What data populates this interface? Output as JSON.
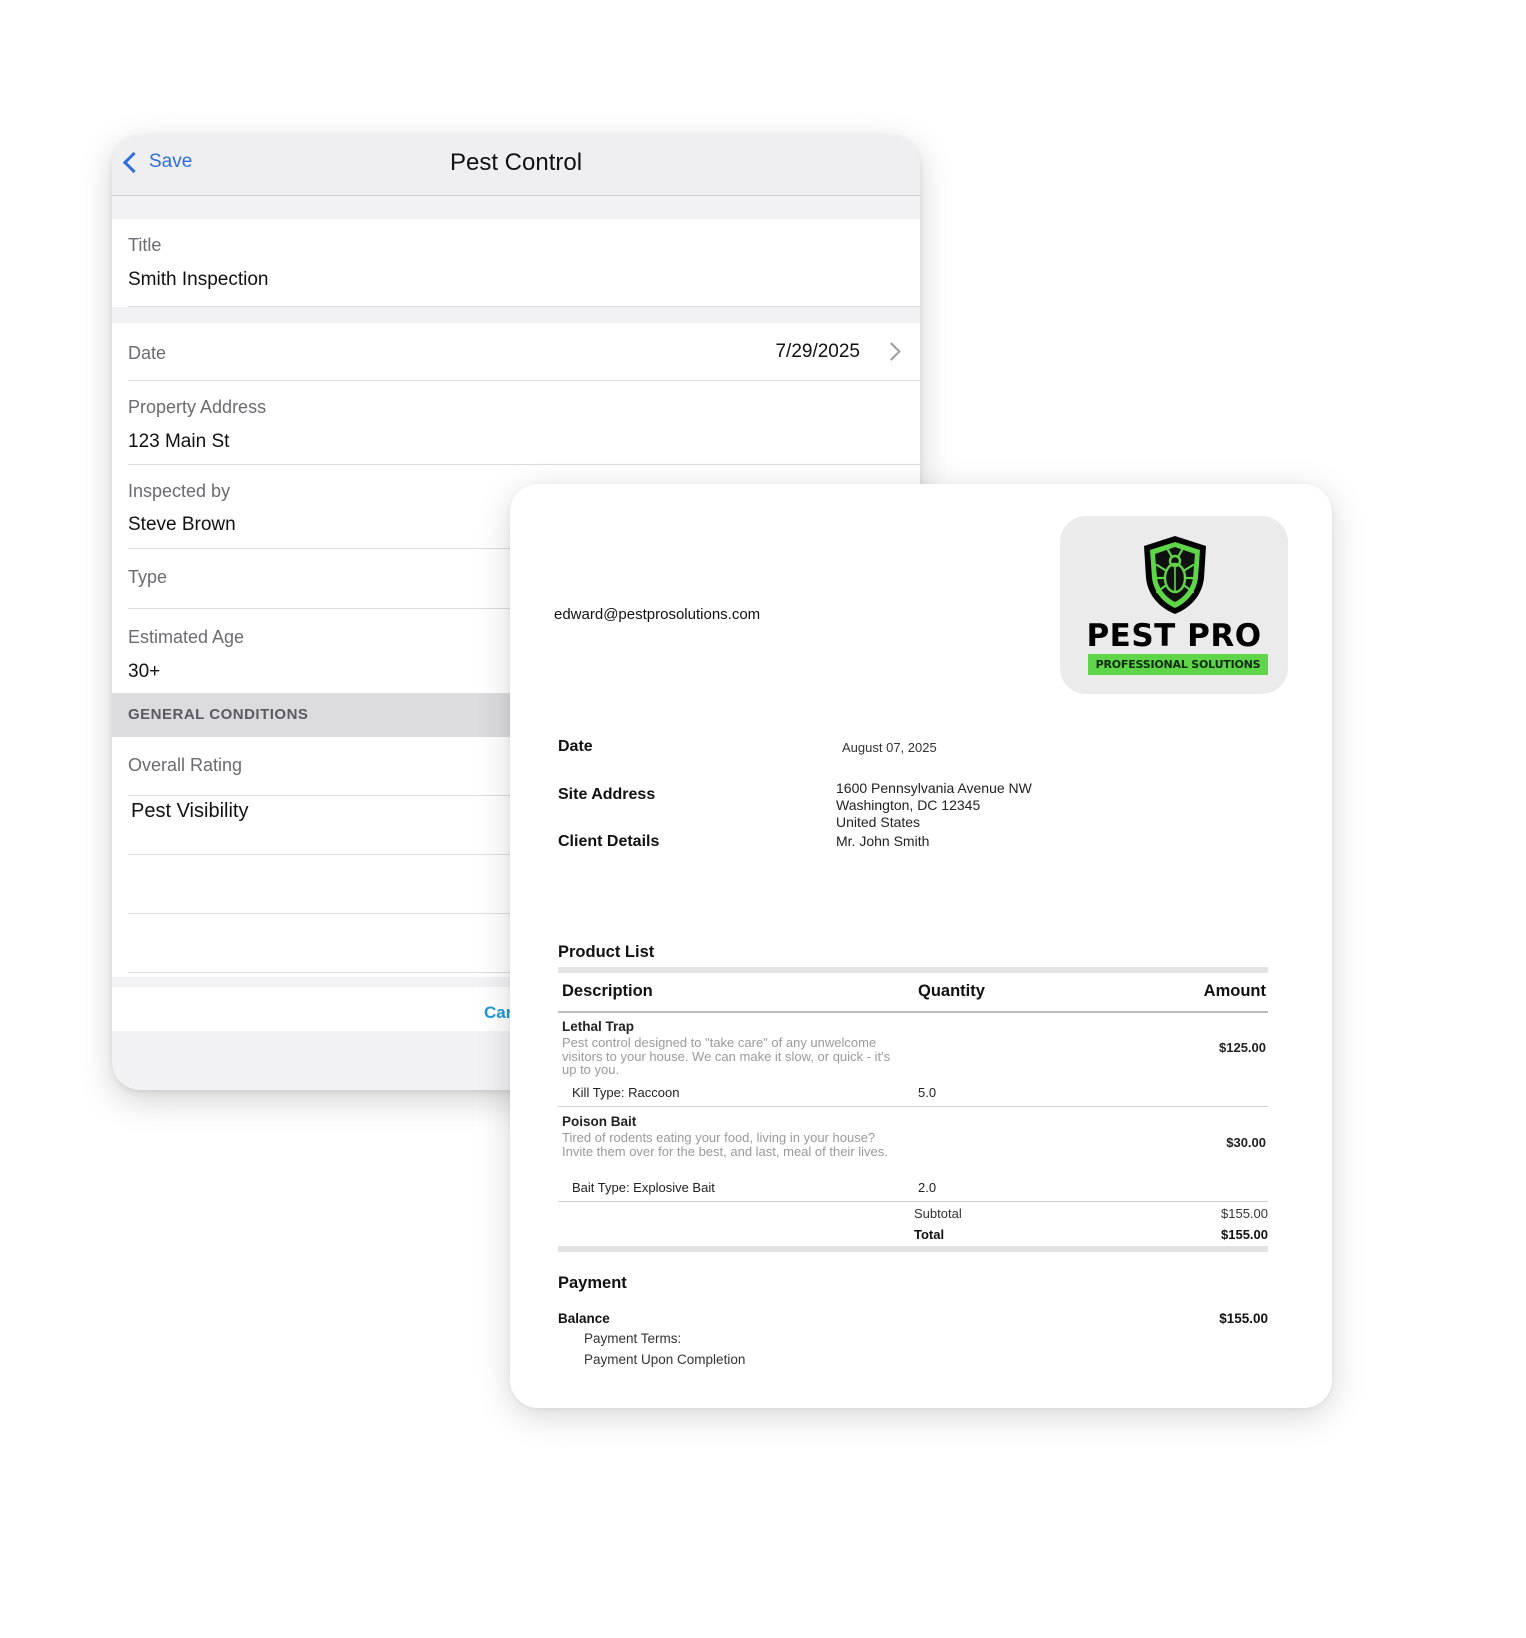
{
  "form": {
    "nav": {
      "back_label": "Save",
      "title": "Pest Control"
    },
    "fields": {
      "title_label": "Title",
      "title_value": "Smith Inspection",
      "date_label": "Date",
      "date_value": "7/29/2025",
      "address_label": "Property Address",
      "address_value": "123 Main St",
      "inspector_label": "Inspected by",
      "inspector_value": "Steve Brown",
      "type_label": "Type",
      "age_label": "Estimated Age",
      "age_value": "30+"
    },
    "section_header": "GENERAL CONDITIONS",
    "overall_rating_label": "Overall Rating",
    "pest_visibility_label": "Pest Visibility",
    "cancel_label_partial": "Car"
  },
  "invoice": {
    "email": "edward@pestprosolutions.com",
    "logo": {
      "name": "PEST PRO",
      "tagline": "PROFESSIONAL SOLUTIONS",
      "accent": "#5fd649"
    },
    "date_label": "Date",
    "date_value": "August 07, 2025",
    "site_label": "Site Address",
    "site_lines": [
      "1600 Pennsylvania Avenue NW",
      "Washington, DC 12345",
      "United States"
    ],
    "client_label": "Client Details",
    "client_value": "Mr. John Smith",
    "product_list_title": "Product List",
    "columns": {
      "description": "Description",
      "quantity": "Quantity",
      "amount": "Amount"
    },
    "items": [
      {
        "name": "Lethal Trap",
        "description": "Pest control designed to \"take care\" of any unwelcome visitors to your house. We can make it slow, or quick - it's up to you.",
        "option": "Kill Type: Raccoon",
        "quantity": "5.0",
        "amount": "$125.00"
      },
      {
        "name": "Poison Bait",
        "description": "Tired of rodents eating your food, living in your house? Invite them over for the best, and last, meal of their lives.",
        "option": "Bait Type: Explosive Bait",
        "quantity": "2.0",
        "amount": "$30.00"
      }
    ],
    "subtotal_label": "Subtotal",
    "subtotal_value": "$155.00",
    "total_label": "Total",
    "total_value": "$155.00",
    "payment_title": "Payment",
    "balance_label": "Balance",
    "balance_value": "$155.00",
    "terms_label": "Payment Terms:",
    "terms_value": "Payment Upon Completion"
  }
}
